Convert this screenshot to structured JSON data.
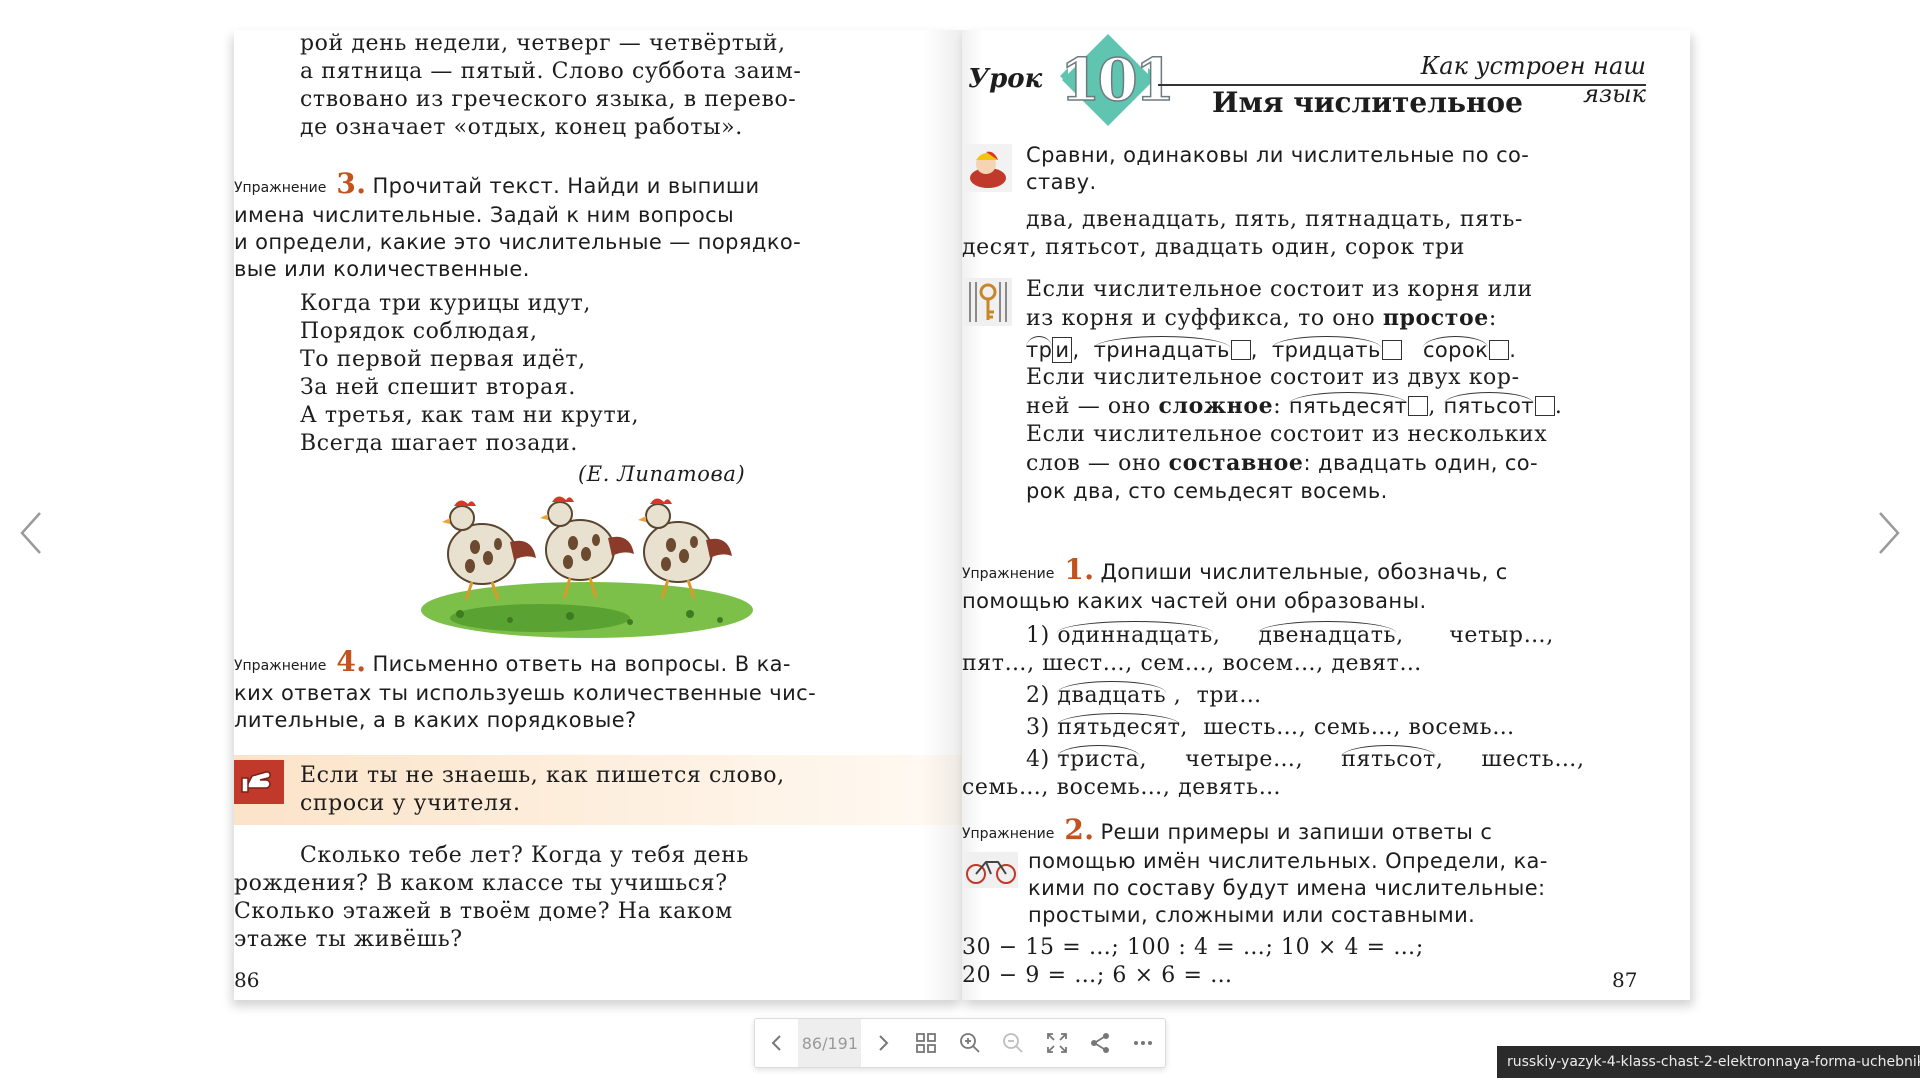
{
  "viewer": {
    "page_indicator": "86/191",
    "file_name": "russkiy-yazyk-4-klass-chast-2-elektronnaya-forma-uchebnika"
  },
  "left_page": {
    "top_lines": [
      "рой  день  недели,  четверг  —  четвёртый,",
      "а  пятница  —  пятый.  Слово  суббота  заим-",
      "ствовано  из  греческого  языка,  в  перево-",
      "де  означает  «отдых,  конец  работы»."
    ],
    "ex3": {
      "label": "Упражнение",
      "number": "3.",
      "first_line": "Прочитай  текст.  Найди  и  выпиши",
      "lines": [
        "имена  числительные.  Задай  к  ним  вопросы",
        "и  определи,  какие  это  числительные  —  порядко-",
        "вые  или  количественные."
      ]
    },
    "poem": [
      "Когда три курицы идут,",
      "Порядок соблюдая,",
      "То первой первая идёт,",
      "За ней спешит вторая.",
      "А третья, как там ни крути,",
      "Всегда шагает позади."
    ],
    "poem_author": "(Е.  Липатова)",
    "ex4": {
      "label": "Упражнение",
      "number": "4.",
      "first_line": "Письменно  ответь  на  вопросы.  В  ка-",
      "lines": [
        "ких  ответах  ты  используешь  количественные  чис-",
        "лительные,  а  в  каких  порядковые?"
      ]
    },
    "tip": [
      "Если  ты  не  знаешь,  как  пишется  слово,",
      "спроси  у  учителя."
    ],
    "questions": [
      "Сколько  тебе  лет?  Когда  у  тебя  день",
      "рождения?  В  каком  классе  ты  учишься?",
      "Сколько  этажей  в  твоём  доме?  На  каком",
      "этаже  ты  живёшь?"
    ],
    "page_number": "86"
  },
  "right_page": {
    "lesson_word": "Урок",
    "lesson_number": "101",
    "section": "Как устроен наш язык",
    "title": "Имя числительное",
    "task": [
      "Сравни,  одинаковы  ли  числительные  по  со-",
      "ставу."
    ],
    "numerals": [
      "два,  двенадцать,  пять,  пятнадцать,  пять-",
      "десят,  пятьсот,  двадцать  один,  сорок  три"
    ],
    "rule": {
      "line1": "Если  числительное  состоит  из  корня  или",
      "line2_start": "из  корня  и  суффикса,  то  оно",
      "simple_word": "простое",
      "simple_examples": [
        "тр",
        "и",
        "тринадцать",
        "тридцать",
        "сорок"
      ],
      "line4": "Если  числительное  состоит  из  двух  кор-",
      "line5_start": "ней  —  оно",
      "complex_word": "сложное",
      "complex_examples": [
        "пятьдесят",
        "пятьсот"
      ],
      "line6": "Если  числительное  состоит  из  нескольких",
      "line7_start": "слов  —  оно",
      "compound_word": "составное",
      "line7_end": ":  двадцать  один,  со-",
      "line8": "рок  два,  сто  семьдесят  восемь."
    },
    "ex1": {
      "label": "Упражнение",
      "number": "1.",
      "first_line": "Допиши  числительные,  обозначь,  с",
      "line2": "помощью  каких  частей  они  образованы.",
      "items": [
        {
          "n": "1)",
          "words": [
            "одиннадцать",
            "двенадцать",
            "четыр…,"
          ],
          "cont": "пят…,  шест…,  сем…,  восем…,  девят…"
        },
        {
          "n": "2)",
          "words": [
            "двадцать",
            "три…"
          ]
        },
        {
          "n": "3)",
          "words": [
            "пятьдесят",
            "шесть…,  семь…,  восемь…"
          ]
        },
        {
          "n": "4)",
          "words": [
            "триста",
            "четыре…,",
            "пятьсот",
            "шесть…,"
          ],
          "cont": "семь…,  восемь…,  девять…"
        }
      ]
    },
    "ex2": {
      "label": "Упражнение",
      "number": "2.",
      "first_line": "Реши  примеры  и  запиши  ответы  с",
      "lines": [
        "помощью  имён  числительных.  Определи,  ка-",
        "кими  по  составу  будут  имена  числительные:",
        "простыми,  сложными  или  составными."
      ],
      "examples_line1": "30  −  15  =  …;   100  :  4  =  …;   10  ×  4  =  …;",
      "examples_line2": "20  −  9  =  …;     6  ×  6  =  …"
    },
    "page_number": "87"
  },
  "colors": {
    "exercise_number": "#c2531f",
    "lesson_badge": "#5fc4b0",
    "tip_band": "#fbe3c8",
    "tip_icon": "#c0392b"
  }
}
